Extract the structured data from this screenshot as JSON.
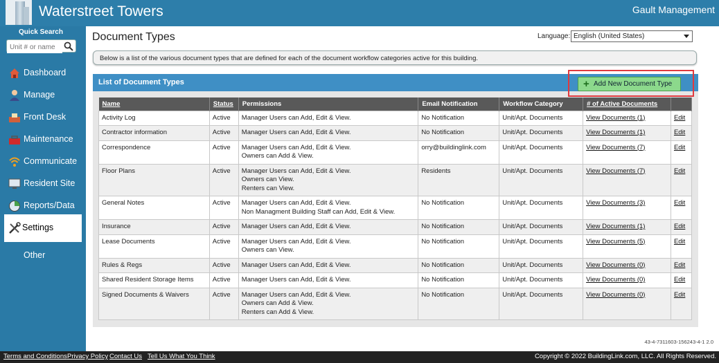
{
  "header": {
    "title": "Waterstreet Towers",
    "company": "Gault Management"
  },
  "sidebar": {
    "quick_search_label": "Quick Search",
    "quick_search_placeholder": "Unit # or name",
    "items": [
      {
        "label": "Dashboard",
        "icon": "dashboard-icon"
      },
      {
        "label": "Manage",
        "icon": "manage-icon"
      },
      {
        "label": "Front Desk",
        "icon": "front-desk-icon"
      },
      {
        "label": "Maintenance",
        "icon": "toolbox-icon"
      },
      {
        "label": "Communicate",
        "icon": "wifi-icon"
      },
      {
        "label": "Resident Site",
        "icon": "monitor-icon"
      },
      {
        "label": "Reports/Data",
        "icon": "pie-chart-icon"
      },
      {
        "label": "Settings",
        "icon": "tools-icon",
        "active": true
      },
      {
        "label": "Other",
        "icon": ""
      }
    ]
  },
  "main": {
    "page_title": "Document Types",
    "language_label": "Language:",
    "language_value": "English (United States)",
    "info_text": "Below is a list of the various document types that are defined for each of the document workflow categories active for this building.",
    "list_title": "List of Document Types",
    "add_button_label": "Add New Document Type",
    "columns": [
      "Name",
      "Status",
      "Permissions",
      "Email Notification",
      "Workflow Category",
      "# of Active Documents",
      ""
    ],
    "rows": [
      {
        "name": "Activity Log",
        "status": "Active",
        "permissions": [
          "Manager Users can Add, Edit & View."
        ],
        "email": "No Notification",
        "category": "Unit/Apt. Documents",
        "docs": "View Documents (1)",
        "edit": "Edit"
      },
      {
        "name": "Contractor information",
        "status": "Active",
        "permissions": [
          "Manager Users can Add, Edit & View."
        ],
        "email": "No Notification",
        "category": "Unit/Apt. Documents",
        "docs": "View Documents (1)",
        "edit": "Edit"
      },
      {
        "name": "Correspondence",
        "status": "Active",
        "permissions": [
          "Manager Users can Add, Edit & View.",
          "Owners can Add & View."
        ],
        "email": "orry@buildinglink.com",
        "category": "Unit/Apt. Documents",
        "docs": "View Documents (7)",
        "edit": "Edit"
      },
      {
        "name": "Floor Plans",
        "status": "Active",
        "permissions": [
          "Manager Users can Add, Edit & View.",
          "Owners can View.",
          "Renters can View."
        ],
        "email": "Residents",
        "category": "Unit/Apt. Documents",
        "docs": "View Documents (7)",
        "edit": "Edit"
      },
      {
        "name": "General Notes",
        "status": "Active",
        "permissions": [
          "Manager Users can Add, Edit & View.",
          "Non Managment Building Staff can Add, Edit & View."
        ],
        "email": "No Notification",
        "category": "Unit/Apt. Documents",
        "docs": "View Documents (3)",
        "edit": "Edit"
      },
      {
        "name": "Insurance",
        "status": "Active",
        "permissions": [
          "Manager Users can Add, Edit & View."
        ],
        "email": "No Notification",
        "category": "Unit/Apt. Documents",
        "docs": "View Documents (1)",
        "edit": "Edit"
      },
      {
        "name": "Lease Documents",
        "status": "Active",
        "permissions": [
          "Manager Users can Add, Edit & View.",
          "Owners can View."
        ],
        "email": "No Notification",
        "category": "Unit/Apt. Documents",
        "docs": "View Documents (5)",
        "edit": "Edit"
      },
      {
        "name": "Rules & Regs",
        "status": "Active",
        "permissions": [
          "Manager Users can Add, Edit & View."
        ],
        "email": "No Notification",
        "category": "Unit/Apt. Documents",
        "docs": "View Documents (0)",
        "edit": "Edit"
      },
      {
        "name": "Shared Resident Storage Items",
        "status": "Active",
        "permissions": [
          "Manager Users can Add, Edit & View."
        ],
        "email": "No Notification",
        "category": "Unit/Apt. Documents",
        "docs": "View Documents (0)",
        "edit": "Edit"
      },
      {
        "name": "Signed Documents & Waivers",
        "status": "Active",
        "permissions": [
          "Manager Users can Add, Edit & View.",
          "Owners can Add & View.",
          "Renters can Add & View."
        ],
        "email": "No Notification",
        "category": "Unit/Apt. Documents",
        "docs": "View Documents (0)",
        "edit": "Edit"
      }
    ],
    "version": "43-4-7311603-156243-4-1 2.0"
  },
  "footer": {
    "links": [
      "Terms and Conditions",
      "Privacy Policy",
      "Contact Us",
      "Tell Us What You Think"
    ],
    "copyright": "Copyright © 2022 BuildingLink.com, LLC.  All Rights Reserved."
  }
}
